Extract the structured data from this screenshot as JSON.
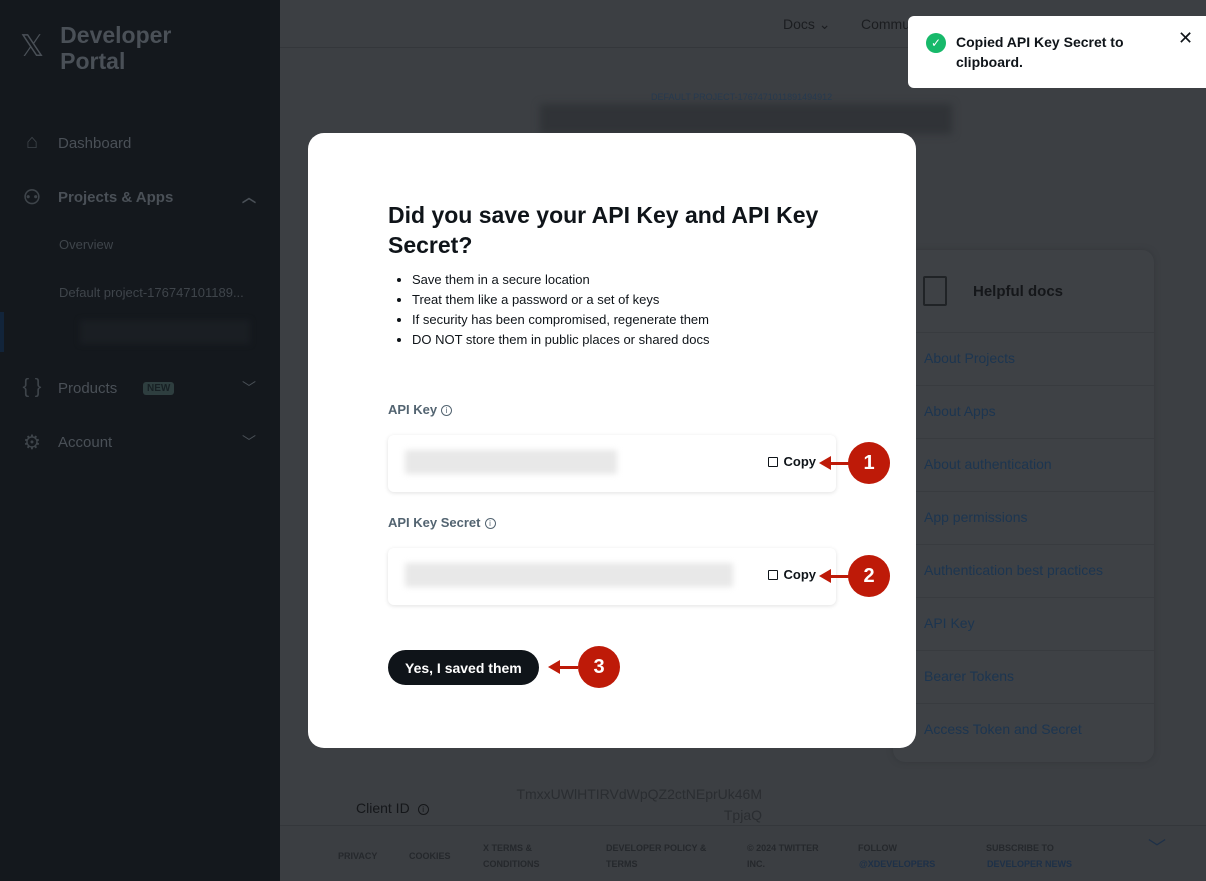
{
  "sidebar": {
    "logo_mark": "𝕏",
    "title": "Developer Portal",
    "items": [
      {
        "label": "Dashboard",
        "icon": "home-icon"
      },
      {
        "label": "Projects & Apps",
        "icon": "hierarchy-icon"
      },
      {
        "label": "Products",
        "icon": "braces-icon",
        "badge": "NEW"
      },
      {
        "label": "Account",
        "icon": "gear-icon"
      }
    ],
    "sub_items": [
      "Overview",
      "Default project-176747101189..."
    ]
  },
  "header": {
    "links": [
      "Docs",
      "Commu"
    ]
  },
  "page": {
    "project_label": "DEFAULT PROJECT-1767471011891494912",
    "client_id_label": "Client ID",
    "client_id_value": "TmxxUWlHTIRVdWpQZ2ctNEprUk46M TpjaQ"
  },
  "helpful_docs": {
    "title": "Helpful docs",
    "links": [
      "About Projects",
      "About Apps",
      "About authentication",
      "App permissions",
      "Authentication best practices",
      "API Key",
      "Bearer Tokens",
      "Access Token and Secret"
    ]
  },
  "footer": {
    "items": [
      "PRIVACY",
      "COOKIES",
      "X TERMS & CONDITIONS",
      "DEVELOPER POLICY & TERMS",
      "© 2024 TWITTER INC."
    ],
    "follow": "FOLLOW",
    "follow_link": "@XDEVELOPERS",
    "subscribe": "SUBSCRIBE TO",
    "subscribe_link": "DEVELOPER NEWS"
  },
  "modal": {
    "title": "Did you save your API Key and API Key Secret?",
    "bullets": [
      "Save them in a secure location",
      "Treat them like a password or a set of keys",
      "If security has been compromised, regenerate them",
      "DO NOT store them in public places or shared docs"
    ],
    "api_key_label": "API Key",
    "api_secret_label": "API Key Secret",
    "copy_label": "Copy",
    "confirm_label": "Yes, I saved them"
  },
  "annotations": [
    "1",
    "2",
    "3"
  ],
  "toast": {
    "message": "Copied API Key Secret to clipboard."
  },
  "colors": {
    "annotation": "#be1a08",
    "success": "#17b96a",
    "primary_button": "#0f1419"
  }
}
